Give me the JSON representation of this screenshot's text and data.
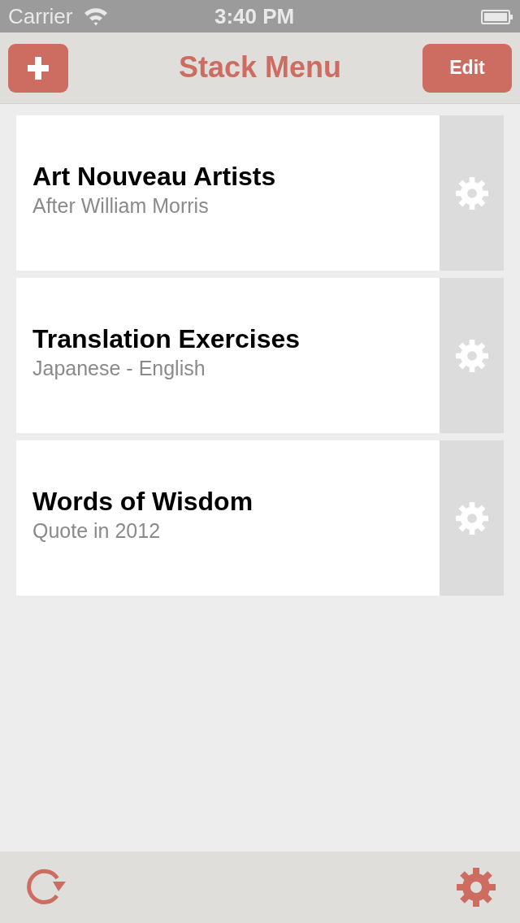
{
  "status_bar": {
    "carrier": "Carrier",
    "time": "3:40 PM"
  },
  "nav_bar": {
    "title": "Stack Menu",
    "right_button": "Edit"
  },
  "stacks": [
    {
      "title": "Art Nouveau Artists",
      "subtitle": "After William Morris"
    },
    {
      "title": "Translation Exercises",
      "subtitle": "Japanese - English"
    },
    {
      "title": "Words of Wisdom",
      "subtitle": "Quote in 2012"
    }
  ]
}
